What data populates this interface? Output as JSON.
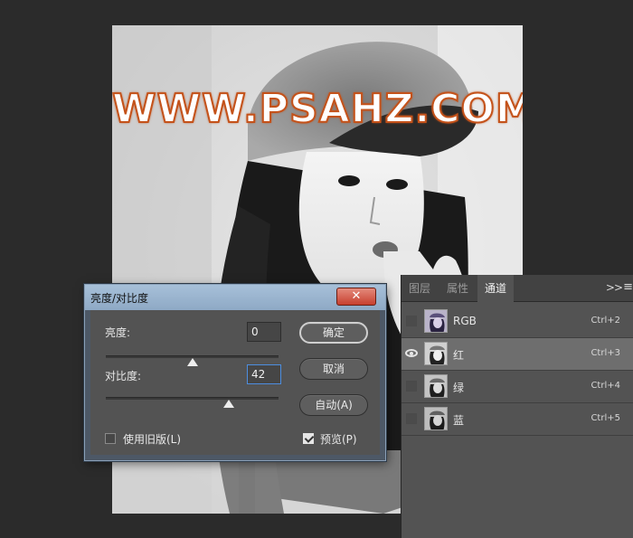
{
  "watermark": "WWW.PSAHZ.COM",
  "dialog": {
    "title": "亮度/对比度",
    "close_label": "✕",
    "brightness_label": "亮度:",
    "brightness_value": "0",
    "brightness_level": 0.5,
    "contrast_label": "对比度:",
    "contrast_value": "42",
    "contrast_level": 0.71,
    "use_legacy_label": "使用旧版(L)",
    "use_legacy_checked": false,
    "ok_label": "确定",
    "cancel_label": "取消",
    "auto_label": "自动(A)",
    "preview_label": "预览(P)",
    "preview_checked": true
  },
  "panel": {
    "tabs": [
      {
        "label": "图层",
        "active": false
      },
      {
        "label": "属性",
        "active": false
      },
      {
        "label": "通道",
        "active": true
      }
    ],
    "menu_icon": "double-chevron-right-icon",
    "channels": [
      {
        "name": "RGB",
        "shortcut": "Ctrl+2",
        "visible": false,
        "selected": false
      },
      {
        "name": "红",
        "shortcut": "Ctrl+3",
        "visible": true,
        "selected": true
      },
      {
        "name": "绿",
        "shortcut": "Ctrl+4",
        "visible": false,
        "selected": false
      },
      {
        "name": "蓝",
        "shortcut": "Ctrl+5",
        "visible": false,
        "selected": false
      }
    ]
  },
  "colors": {
    "watermark_stroke": "#c4521a",
    "dialog_titlebar": "#a7c0d9",
    "close_button": "#c7402f",
    "panel_bg": "#535353",
    "selected_row": "#6e6e6e"
  }
}
